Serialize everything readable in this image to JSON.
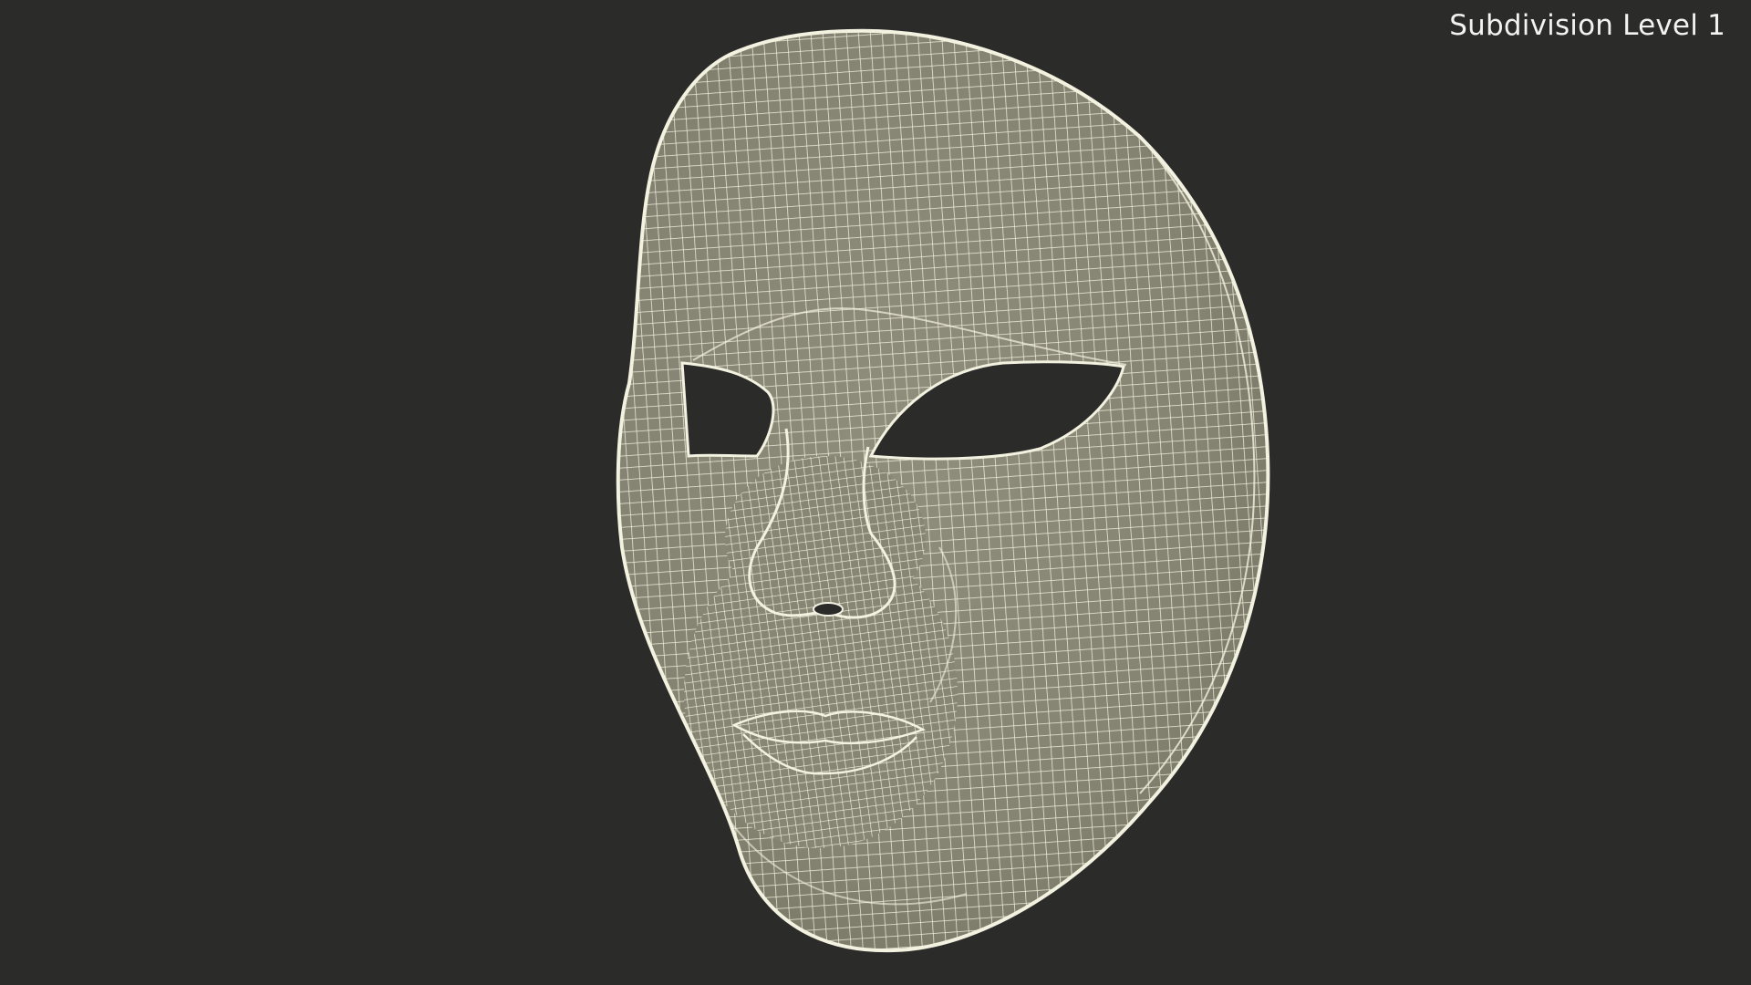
{
  "viewport": {
    "label": "Subdivision Level 1",
    "subject": "mask-wireframe-render",
    "colors": {
      "background": "#2b2b2a",
      "surface": "#8c8a78",
      "wire": "#f3f1df",
      "label": "#f2f2f0"
    }
  }
}
